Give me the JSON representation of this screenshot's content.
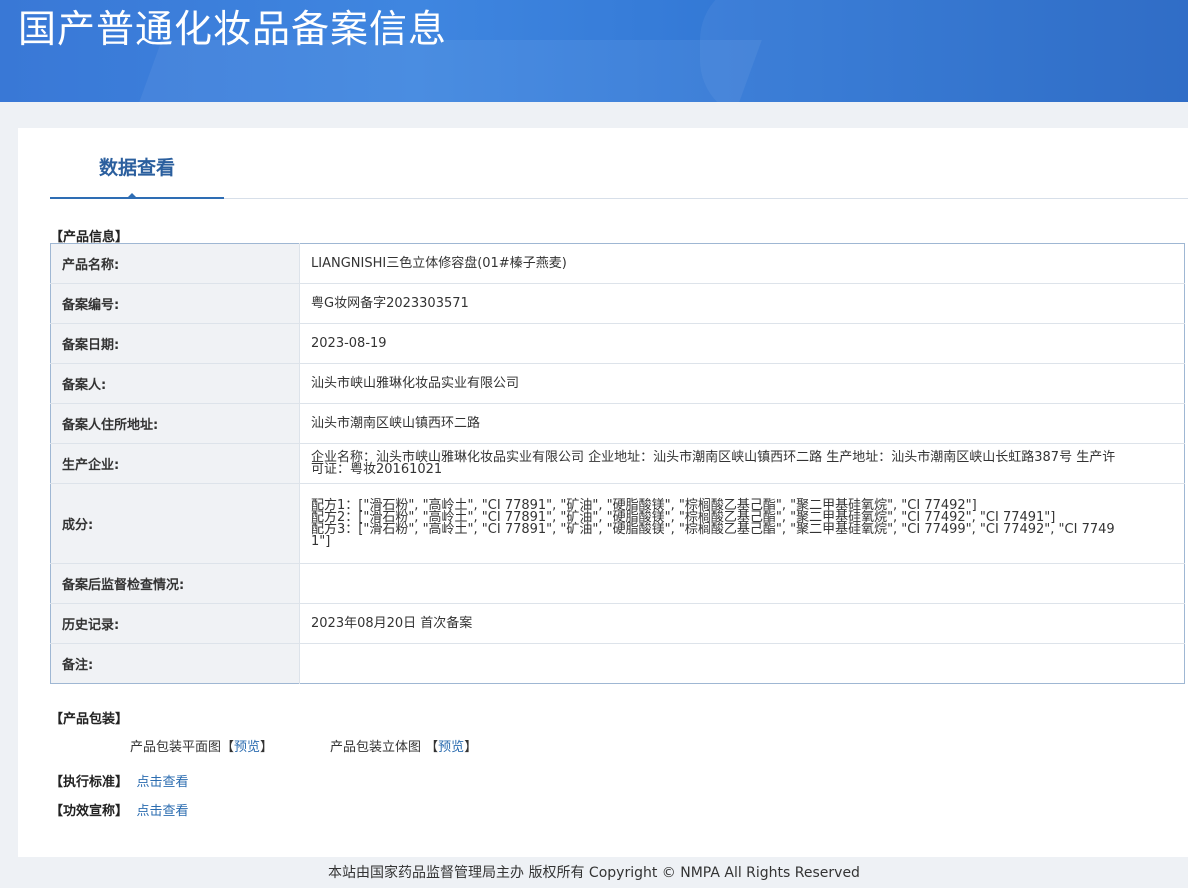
{
  "header": {
    "title": "国产普通化妆品备案信息"
  },
  "tabs": [
    {
      "label": "数据查看"
    }
  ],
  "product_section": {
    "heading": "【产品信息】"
  },
  "rows": [
    {
      "label": "产品名称:",
      "lines": [
        "LIANGNISHI三色立体修容盘(01#榛子燕麦)"
      ]
    },
    {
      "label": "备案编号:",
      "lines": [
        "粤G妆网备字2023303571"
      ]
    },
    {
      "label": "备案日期:",
      "lines": [
        "2023-08-19"
      ]
    },
    {
      "label": "备案人:",
      "lines": [
        "汕头市峡山雅琳化妆品实业有限公司"
      ]
    },
    {
      "label": "备案人住所地址:",
      "lines": [
        "汕头市潮南区峡山镇西环二路"
      ]
    },
    {
      "label": "生产企业:",
      "lines": [
        "企业名称：汕头市峡山雅琳化妆品实业有限公司 企业地址：汕头市潮南区峡山镇西环二路 生产地址：汕头市潮南区峡山长虹路387号 生产许可证：粤妆20161021"
      ]
    },
    {
      "label": "成分:",
      "lines": [
        "配方1：[\"滑石粉\", \"高岭土\", \"CI 77891\", \"矿油\", \"硬脂酸镁\", \"棕榈酸乙基己酯\", \"聚二甲基硅氧烷\", \"CI 77492\"]",
        "配方2：[\"滑石粉\", \"高岭土\", \"CI 77891\", \"矿油\", \"硬脂酸镁\", \"棕榈酸乙基己酯\", \"聚二甲基硅氧烷\", \"CI 77492\", \"CI 77491\"]",
        "配方3：[\"滑石粉\", \"高岭土\", \"CI 77891\", \"矿油\", \"硬脂酸镁\", \"棕榈酸乙基己酯\", \"聚二甲基硅氧烷\", \"CI 77499\", \"CI 77492\", \"CI 77491\"]"
      ]
    },
    {
      "label": "备案后监督检查情况:",
      "lines": [
        ""
      ]
    },
    {
      "label": "历史记录:",
      "lines": [
        "2023年08月20日 首次备案"
      ]
    },
    {
      "label": "备注:",
      "lines": [
        ""
      ]
    }
  ],
  "packaging": {
    "heading": "【产品包装】",
    "flat_label": "产品包装平面图",
    "flat_link": "预览",
    "solid_label": "产品包装立体图",
    "solid_link": "预览",
    "bracket_open": "【",
    "bracket_close": "】"
  },
  "standard": {
    "heading": "【执行标准】",
    "link": "点击查看"
  },
  "efficacy": {
    "heading": "【功效宣称】",
    "link": "点击查看"
  },
  "footer": {
    "text": "本站由国家药品监督管理局主办 版权所有 Copyright © NMPA All Rights Reserved"
  },
  "colors": {
    "banner": "#3978d6",
    "link": "#2b6cb0",
    "tab_accent": "#2e6db4"
  }
}
